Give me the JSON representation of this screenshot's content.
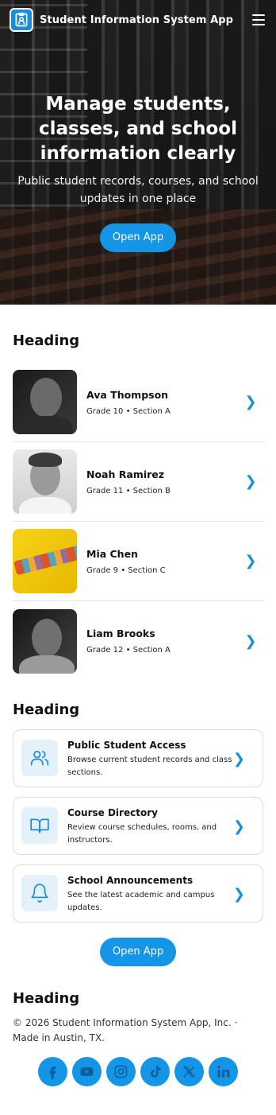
{
  "header": {
    "brand": "Student Information System App",
    "logo_icon": "student-id-icon",
    "menu_icon": "hamburger-menu-icon"
  },
  "hero": {
    "title": "Manage students, classes, and school information clearly",
    "subtitle": "Public student records, courses, and school updates in one place",
    "cta": "Open App"
  },
  "students_section": {
    "heading": "Heading",
    "items": [
      {
        "name": "Ava Thompson",
        "meta": "Grade 10 • Section A"
      },
      {
        "name": "Noah Ramirez",
        "meta": "Grade 11 • Section B"
      },
      {
        "name": "Mia Chen",
        "meta": "Grade 9 • Section C"
      },
      {
        "name": "Liam Brooks",
        "meta": "Grade 12 • Section A"
      }
    ]
  },
  "features_section": {
    "heading": "Heading",
    "items": [
      {
        "title": "Public Student Access",
        "desc": "Browse current student records and class sections.",
        "icon": "users-icon"
      },
      {
        "title": "Course Directory",
        "desc": "Review course schedules, rooms, and instructors.",
        "icon": "book-icon"
      },
      {
        "title": "School Announcements",
        "desc": "See the latest academic and campus updates.",
        "icon": "bell-icon"
      }
    ],
    "cta": "Open App"
  },
  "footer": {
    "heading": "Heading",
    "copyright": "© 2026 Student Information System App, Inc. · Made in Austin, TX.",
    "socials": [
      "facebook-icon",
      "youtube-icon",
      "instagram-icon",
      "tiktok-icon",
      "x-icon",
      "linkedin-icon"
    ]
  },
  "colors": {
    "accent": "#1495e6",
    "icon_bg": "#e4f1fb"
  }
}
